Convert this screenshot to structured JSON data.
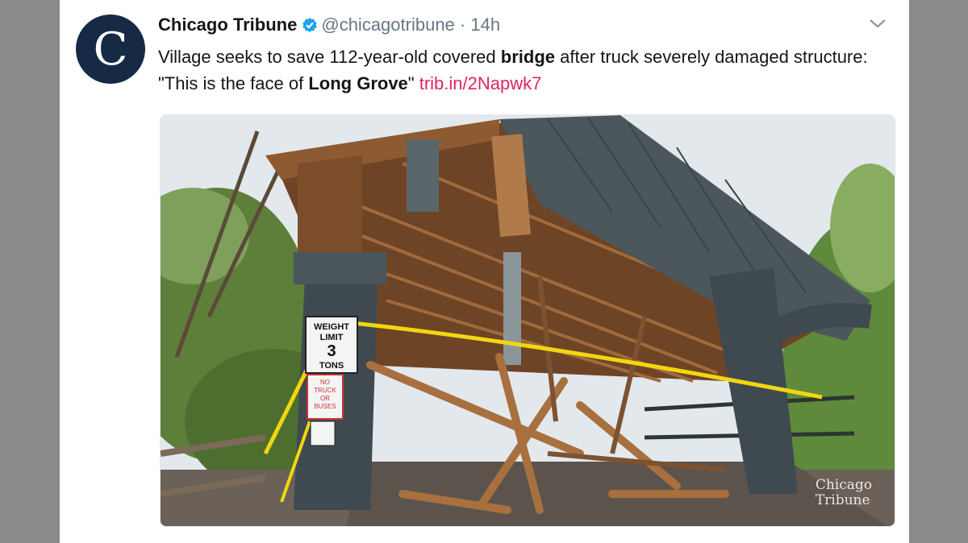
{
  "tweet": {
    "display_name": "Chicago Tribune",
    "handle": "@chicagotribune",
    "separator": "·",
    "time": "14h",
    "text_parts": {
      "p1": "Village seeks to save 112-year-old covered ",
      "b1": "bridge",
      "p2": " after truck severely damaged structure: \"This is the face of ",
      "b2": "Long Grove",
      "p3": "\" ",
      "link": "trib.in/2Napwk7"
    },
    "avatar_letter": "C",
    "icons": {
      "verified": "verified-badge-icon",
      "caret": "chevron-down-icon"
    }
  },
  "media": {
    "sign_weight": [
      "WEIGHT",
      "LIMIT",
      "3",
      "TONS"
    ],
    "sign_no_trucks": [
      "NO",
      "TRUCK",
      "OR",
      "BUSES"
    ],
    "watermark_line1": "Chicago",
    "watermark_line2": "Tribune"
  },
  "colors": {
    "brand_navy": "#162a45",
    "verified_blue": "#1da1f2",
    "link_red": "#e0245e",
    "caution_yellow": "#f2d60f",
    "bridge_gray": "#3e4a50",
    "wood": "#8a5a34"
  }
}
